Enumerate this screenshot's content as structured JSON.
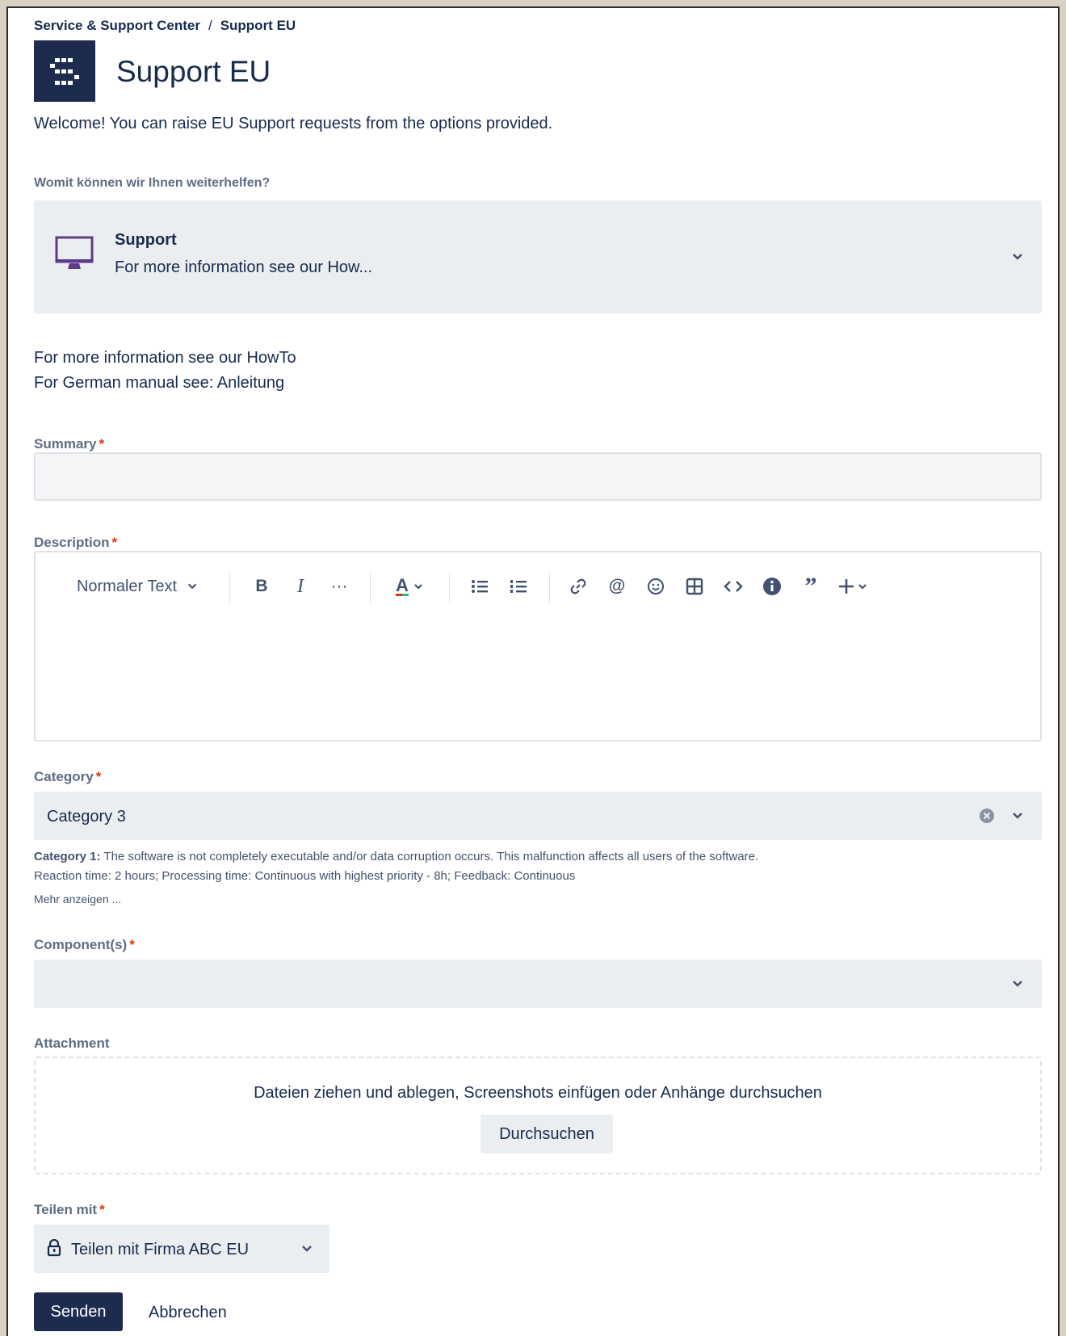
{
  "breadcrumb": {
    "root": "Service & Support Center",
    "separator": "/",
    "current": "Support EU"
  },
  "page": {
    "title": "Support EU",
    "welcome": "Welcome! You can raise EU Support requests from the options provided."
  },
  "request_type": {
    "question": "Womit können wir Ihnen weiterhelfen?",
    "name": "Support",
    "description": "For more information see our How...",
    "icon": "monitor-icon",
    "icon_color": "#5e3b8a"
  },
  "info": {
    "line1": "For more information see our HowTo",
    "line2": "For German manual see: Anleitung"
  },
  "summary": {
    "label": "Summary",
    "required_marker": "*",
    "value": ""
  },
  "description": {
    "label": "Description",
    "required_marker": "*",
    "toolbar": {
      "text_style": "Normaler Text",
      "icons": [
        "bold-icon",
        "italic-icon",
        "more-icon",
        "text-color-icon",
        "bullet-list-icon",
        "numbered-list-icon",
        "link-icon",
        "mention-icon",
        "emoji-icon",
        "table-icon",
        "code-icon",
        "info-panel-icon",
        "quote-icon",
        "insert-icon"
      ]
    }
  },
  "category": {
    "label": "Category",
    "required_marker": "*",
    "value": "Category 3",
    "help_title": "Category 1:",
    "help_line1": " The software is not completely executable and/or data corruption occurs. This malfunction affects all users of the software.",
    "help_line2": "Reaction time: 2 hours; Processing time: Continuous with highest priority - 8h; Feedback: Continuous",
    "show_more": "Mehr anzeigen ..."
  },
  "components": {
    "label": "Component(s)",
    "required_marker": "*",
    "value": ""
  },
  "attachment": {
    "label": "Attachment",
    "dropzone_text": "Dateien ziehen und ablegen, Screenshots einfügen oder Anhänge durchsuchen",
    "browse_label": "Durchsuchen"
  },
  "share": {
    "label": "Teilen mit",
    "required_marker": "*",
    "value": "Teilen mit Firma ABC EU"
  },
  "actions": {
    "submit": "Senden",
    "cancel": "Abbrechen"
  },
  "colors": {
    "primary": "#1d2b4f",
    "field_bg": "#ebeef0",
    "required": "#de350b",
    "text": "#172b4d",
    "label": "#5e6c84"
  }
}
